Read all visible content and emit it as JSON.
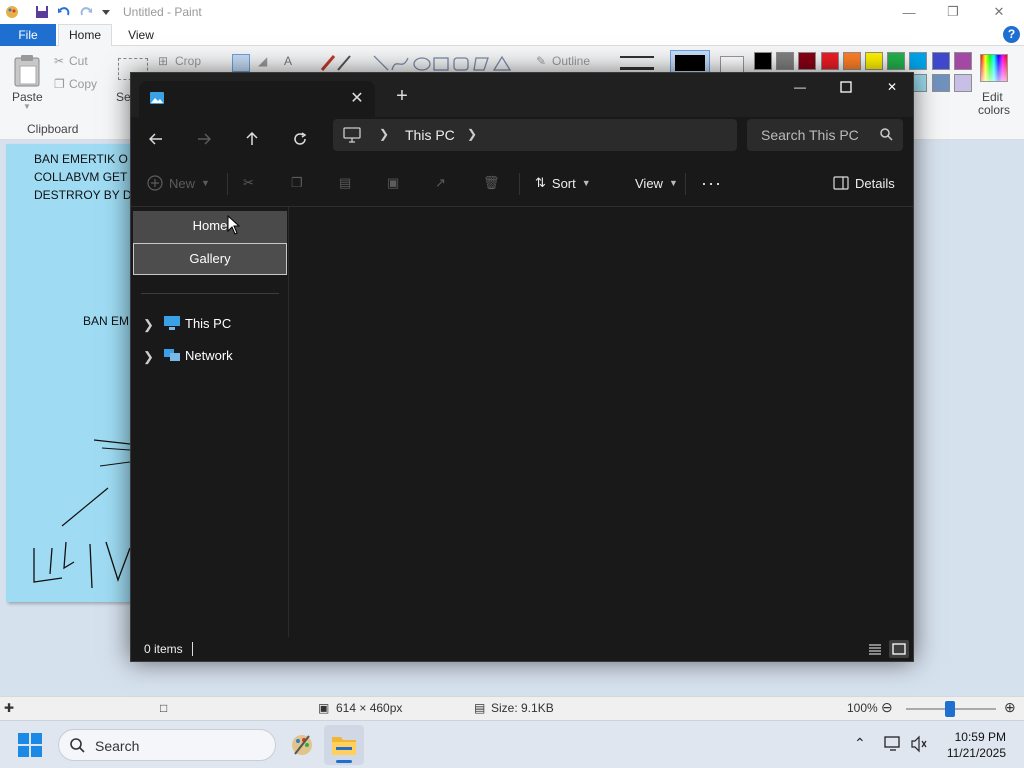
{
  "paint": {
    "title": "Untitled - Paint",
    "tabs": {
      "file": "File",
      "home": "Home",
      "view": "View"
    },
    "help": "?",
    "ribbon": {
      "paste": "Paste",
      "cut": "Cut",
      "copy": "Copy",
      "crop": "Crop",
      "select": "Se",
      "outline": "Outline",
      "edit_colors_line1": "Edit",
      "edit_colors_line2": "colors",
      "clipboard_group": "Clipboard"
    },
    "palette_row1": [
      "#000000",
      "#7f7f7f",
      "#880015",
      "#ed1c24",
      "#ff7f27",
      "#fff200",
      "#22b14c",
      "#00a2e8",
      "#3f48cc",
      "#a349a4"
    ],
    "palette_row2": [
      "#ffffff",
      "#c3c3c3",
      "#b97a57",
      "#ffaec9",
      "#ffc90e",
      "#efe4b0",
      "#b5e61d",
      "#99d9ea",
      "#7092be",
      "#c8bfe7"
    ],
    "drawing_lines": [
      "BAN EMERTIK O",
      "COLLABVM GET",
      "DESTRROY BY DE",
      "BAN EM"
    ],
    "status": {
      "dimensions": "614 × 460px",
      "size": "Size: 9.1KB",
      "zoom": "100%"
    }
  },
  "explorer": {
    "address": {
      "crumb": "This PC"
    },
    "search_placeholder": "Search This PC",
    "commands": {
      "new": "New",
      "sort": "Sort",
      "view": "View",
      "details": "Details"
    },
    "sidebar": {
      "quick": [
        "Home",
        "Gallery"
      ],
      "tree": [
        "This PC",
        "Network"
      ]
    },
    "status": {
      "count": "0 items"
    }
  },
  "taskbar": {
    "search_placeholder": "Search",
    "time": "10:59 PM",
    "date": "11/21/2025"
  }
}
